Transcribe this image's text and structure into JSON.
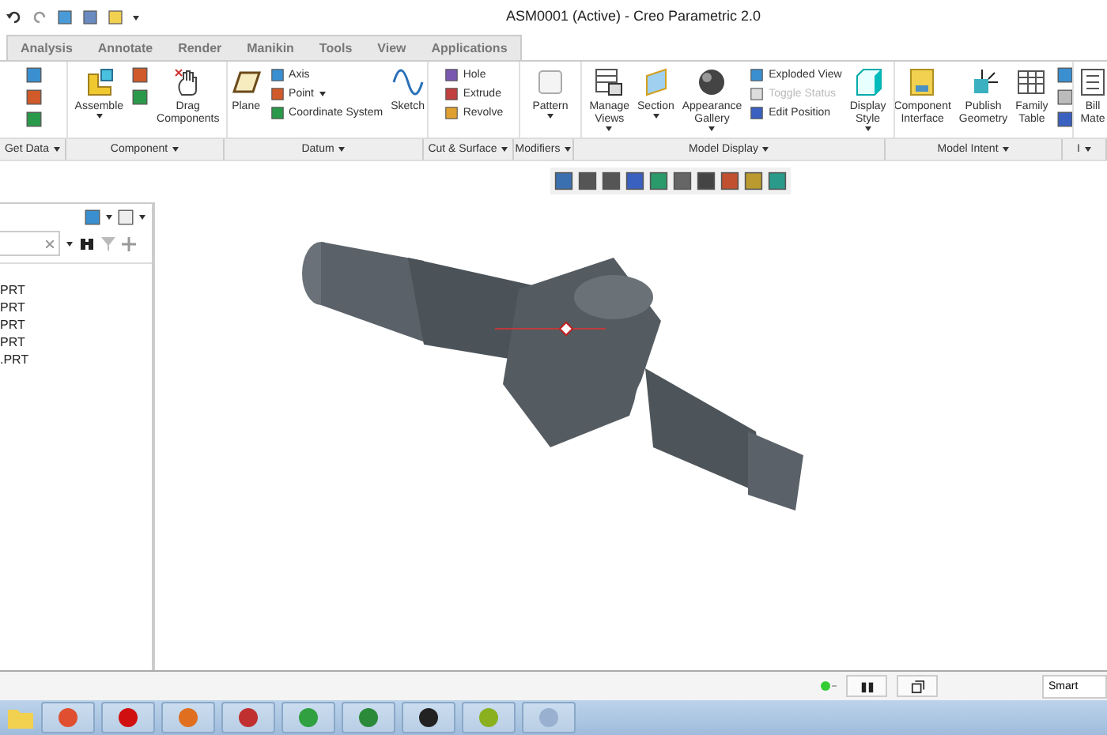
{
  "window": {
    "title": "ASM0001 (Active) - Creo Parametric 2.0"
  },
  "tabs": [
    {
      "label": "Analysis",
      "selected": false
    },
    {
      "label": "Annotate",
      "selected": false
    },
    {
      "label": "Render",
      "selected": false
    },
    {
      "label": "Manikin",
      "selected": false
    },
    {
      "label": "Tools",
      "selected": false
    },
    {
      "label": "View",
      "selected": false
    },
    {
      "label": "Applications",
      "selected": false
    }
  ],
  "ribbon_groups": [
    {
      "label": "Get Data",
      "items": [
        {
          "kind": "icons"
        }
      ]
    },
    {
      "label": "Component",
      "items": [
        {
          "kind": "large",
          "label": "Assemble",
          "caret": true
        },
        {
          "kind": "icons"
        },
        {
          "kind": "large",
          "label": "Drag\nComponents",
          "caret": false
        }
      ]
    },
    {
      "label": "Datum",
      "items": [
        {
          "kind": "large",
          "label": "Plane",
          "caret": false
        },
        {
          "kind": "small",
          "entries": [
            {
              "label": "Axis",
              "caret": false,
              "disabled": false
            },
            {
              "label": "Point",
              "caret": true,
              "disabled": false
            },
            {
              "label": "Coordinate System",
              "caret": false,
              "disabled": false
            }
          ]
        },
        {
          "kind": "large",
          "label": "Sketch",
          "caret": false
        }
      ]
    },
    {
      "label": "Cut & Surface",
      "items": [
        {
          "kind": "small",
          "entries": [
            {
              "label": "Hole",
              "caret": false,
              "disabled": false
            },
            {
              "label": "Extrude",
              "caret": false,
              "disabled": false
            },
            {
              "label": "Revolve",
              "caret": false,
              "disabled": false
            }
          ]
        }
      ]
    },
    {
      "label": "Modifiers",
      "items": [
        {
          "kind": "large",
          "label": "Pattern",
          "caret": true
        }
      ]
    },
    {
      "label": "Model Display",
      "items": [
        {
          "kind": "large",
          "label": "Manage\nViews",
          "caret": true
        },
        {
          "kind": "large",
          "label": "Section",
          "caret": true
        },
        {
          "kind": "large",
          "label": "Appearance\nGallery",
          "caret": true
        },
        {
          "kind": "small",
          "entries": [
            {
              "label": "Exploded View",
              "caret": false,
              "disabled": false
            },
            {
              "label": "Toggle Status",
              "caret": false,
              "disabled": true
            },
            {
              "label": "Edit Position",
              "caret": false,
              "disabled": false
            }
          ]
        },
        {
          "kind": "large",
          "label": "Display\nStyle",
          "caret": true
        }
      ]
    },
    {
      "label": "Model Intent",
      "items": [
        {
          "kind": "large",
          "label": "Component\nInterface",
          "caret": false
        },
        {
          "kind": "large",
          "label": "Publish\nGeometry",
          "caret": false
        },
        {
          "kind": "large",
          "label": "Family\nTable",
          "caret": false
        },
        {
          "kind": "icons"
        }
      ]
    },
    {
      "label": "I",
      "items": [
        {
          "kind": "large",
          "label": "Bill\nMate",
          "caret": false
        }
      ]
    }
  ],
  "model_tree": {
    "items": [
      {
        "label": "PRT"
      },
      {
        "label": "PRT"
      },
      {
        "label": "PRT"
      },
      {
        "label": "PRT"
      },
      {
        "label": ".PRT"
      }
    ]
  },
  "status_bar": {
    "selection_filter": "Smart"
  }
}
